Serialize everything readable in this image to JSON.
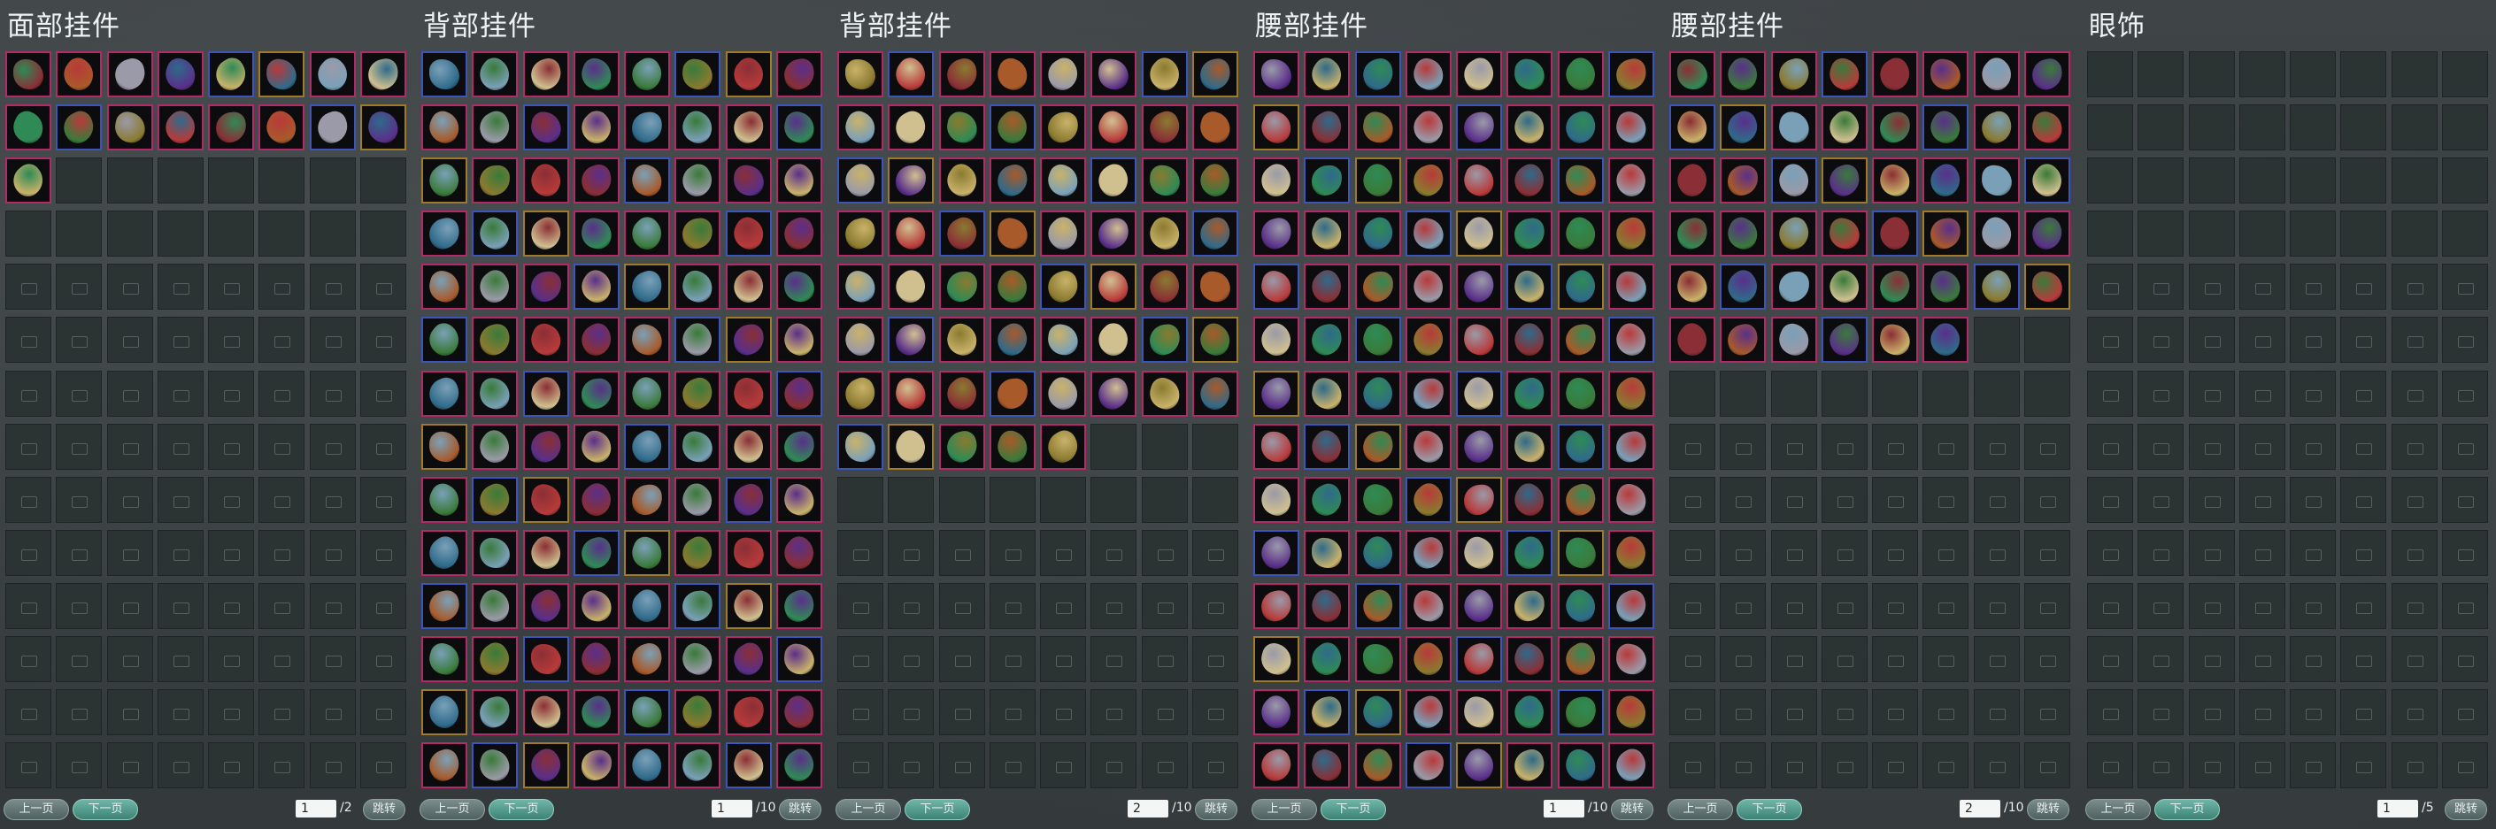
{
  "colors": {
    "rare_border": "#b22a67",
    "epic_border": "#3d55b8",
    "gold_border": "#9e7b2b",
    "next_button": "#3c8376"
  },
  "panels": [
    {
      "title": "面部挂件",
      "page_current": "1",
      "page_total": "/2",
      "prev_label": "上一页",
      "next_label": "下一页",
      "jump_label": "跳转",
      "filled": 17,
      "empty": 15,
      "locked_rows": 10,
      "slot_icon": "item-icon",
      "items_description": [
        "mask-icon",
        "mahjong-tile-icon",
        "face-ornament-icon"
      ]
    },
    {
      "title": "背部挂件",
      "page_current": "1",
      "page_total": "/10",
      "prev_label": "上一页",
      "next_label": "下一页",
      "jump_label": "跳转",
      "filled": 112,
      "empty": 0,
      "locked_rows": 0,
      "slot_icon": "item-icon"
    },
    {
      "title": "背部挂件",
      "page_current": "2",
      "page_total": "/10",
      "prev_label": "上一页",
      "next_label": "下一页",
      "jump_label": "跳转",
      "filled": 61,
      "empty": 11,
      "locked_rows": 5,
      "slot_icon": "item-icon"
    },
    {
      "title": "腰部挂件",
      "page_current": "1",
      "page_total": "/10",
      "prev_label": "上一页",
      "next_label": "下一页",
      "jump_label": "跳转",
      "filled": 112,
      "empty": 0,
      "locked_rows": 0,
      "slot_icon": "item-icon"
    },
    {
      "title": "腰部挂件",
      "page_current": "2",
      "page_total": "/10",
      "prev_label": "上一页",
      "next_label": "下一页",
      "jump_label": "跳转",
      "filled": 46,
      "empty": 10,
      "locked_rows": 7,
      "slot_icon": "item-icon"
    },
    {
      "title": "眼饰",
      "page_current": "1",
      "page_total": "/5",
      "prev_label": "上一页",
      "next_label": "下一页",
      "jump_label": "跳转",
      "filled": 0,
      "empty": 32,
      "locked_rows": 10,
      "slot_icon": "item-icon"
    }
  ]
}
